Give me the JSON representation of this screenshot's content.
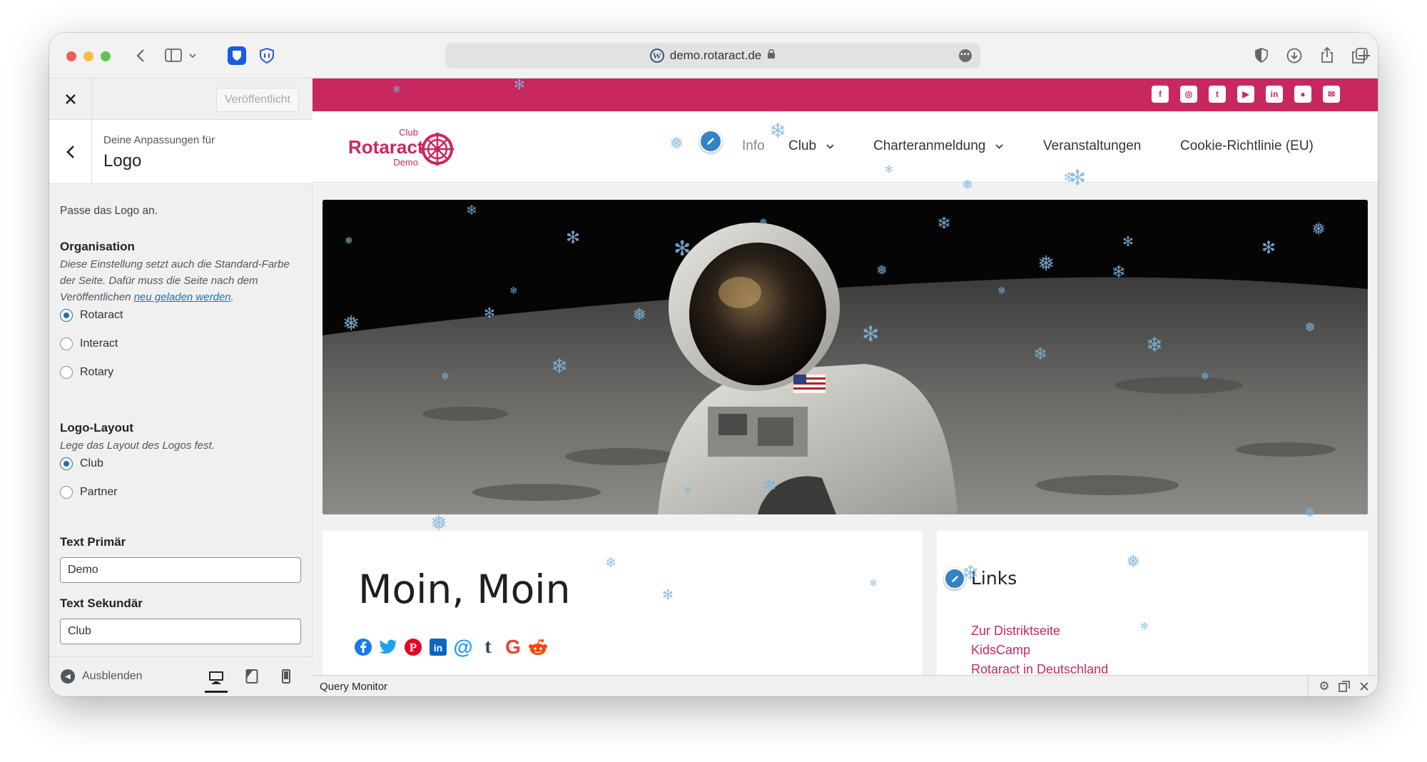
{
  "browser": {
    "url": "demo.rotaract.de",
    "sidebar_toggle_icon": "sidebar-icon",
    "extensions": [
      "bitwarden-icon",
      "privacy-shield-icon"
    ],
    "right_icons": [
      "shield-half-icon",
      "download-icon",
      "share-icon",
      "tabs-icon",
      "plus-icon"
    ]
  },
  "customizer": {
    "publish_label": "Veröffentlicht",
    "section_sub": "Deine Anpassungen für",
    "section_title": "Logo",
    "intro": "Passe das Logo an.",
    "organisation": {
      "label": "Organisation",
      "desc_1": "Diese Einstellung setzt auch die Standard-Farbe der Seite. Dafür muss die Seite nach dem Veröffentlichen ",
      "desc_link": "neu geladen werden",
      "desc_2": ".",
      "options": [
        "Rotaract",
        "Interact",
        "Rotary"
      ],
      "selected": "Rotaract"
    },
    "layout": {
      "label": "Logo-Layout",
      "desc": "Lege das Layout des Logos fest.",
      "options": [
        "Club",
        "Partner"
      ],
      "selected": "Club"
    },
    "text_primary": {
      "label": "Text Primär",
      "value": "Demo"
    },
    "text_secondary": {
      "label": "Text Sekundär",
      "value": "Club"
    },
    "hide_label": "Ausblenden",
    "devices": [
      "desktop-icon",
      "tablet-icon",
      "mobile-icon"
    ]
  },
  "site": {
    "accent": "#c8285f",
    "social": [
      "facebook-icon",
      "instagram-icon",
      "twitter-icon",
      "youtube-icon",
      "linkedin-icon",
      "github-icon",
      "mail-icon"
    ],
    "logo": {
      "club": "Club",
      "main": "Rotaract",
      "demo": "Demo"
    },
    "nav": [
      "Info",
      "Club",
      "Charteranmeldung",
      "Veranstaltungen",
      "Cookie-Richtlinie (EU)"
    ],
    "heading": "Moin, Moin",
    "share": [
      {
        "name": "facebook",
        "color": "#1877f2",
        "glyph": "f"
      },
      {
        "name": "twitter",
        "color": "#1da1f2",
        "glyph": "t"
      },
      {
        "name": "pinterest",
        "color": "#e60023",
        "glyph": "P"
      },
      {
        "name": "linkedin",
        "color": "#0a66c2",
        "glyph": "in"
      },
      {
        "name": "email",
        "color": "#1d9bf0",
        "glyph": "@"
      },
      {
        "name": "tumblr",
        "color": "#35465c",
        "glyph": "t"
      },
      {
        "name": "google",
        "color": "#ea4335",
        "glyph": "G"
      },
      {
        "name": "reddit",
        "color": "#ff4500",
        "glyph": "r"
      }
    ],
    "links_title": "Links",
    "links": [
      "Zur Distriktseite",
      "KidsCamp",
      "Rotaract in Deutschland"
    ]
  },
  "query_monitor": {
    "label": "Query Monitor"
  }
}
